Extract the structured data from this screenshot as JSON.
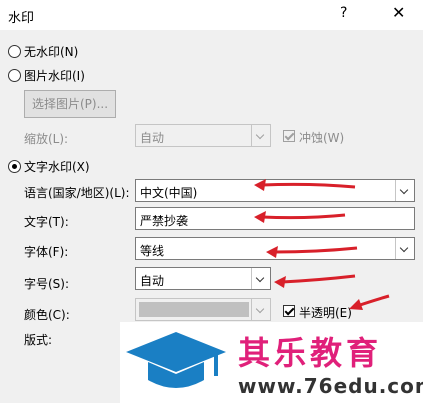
{
  "window": {
    "title": "水印",
    "help_symbol": "?",
    "close_symbol": "✕"
  },
  "options": {
    "no_watermark": "无水印(N)",
    "picture_watermark": "图片水印(I)",
    "select_picture_button": "选择图片(P)...",
    "scale_label": "缩放(L):",
    "scale_value": "自动",
    "washout_label": "冲蚀(W)",
    "text_watermark": "文字水印(X)"
  },
  "text_watermark": {
    "language_label": "语言(国家/地区)(L):",
    "language_value": "中文(中国)",
    "text_label": "文字(T):",
    "text_value": "严禁抄袭",
    "font_label": "字体(F):",
    "font_value": "等线",
    "size_label": "字号(S):",
    "size_value": "自动",
    "color_label": "颜色(C):",
    "semi_transparent_label": "半透明(E)",
    "layout_label": "版式:"
  },
  "overlay": {
    "brand": "其乐教育",
    "url": "www.76edu.com"
  },
  "colors": {
    "arrow": "#d8202a",
    "brand": "#e0207a",
    "logo": "#1a7fc4"
  },
  "icons": {
    "logo": "graduation-cap-icon"
  }
}
